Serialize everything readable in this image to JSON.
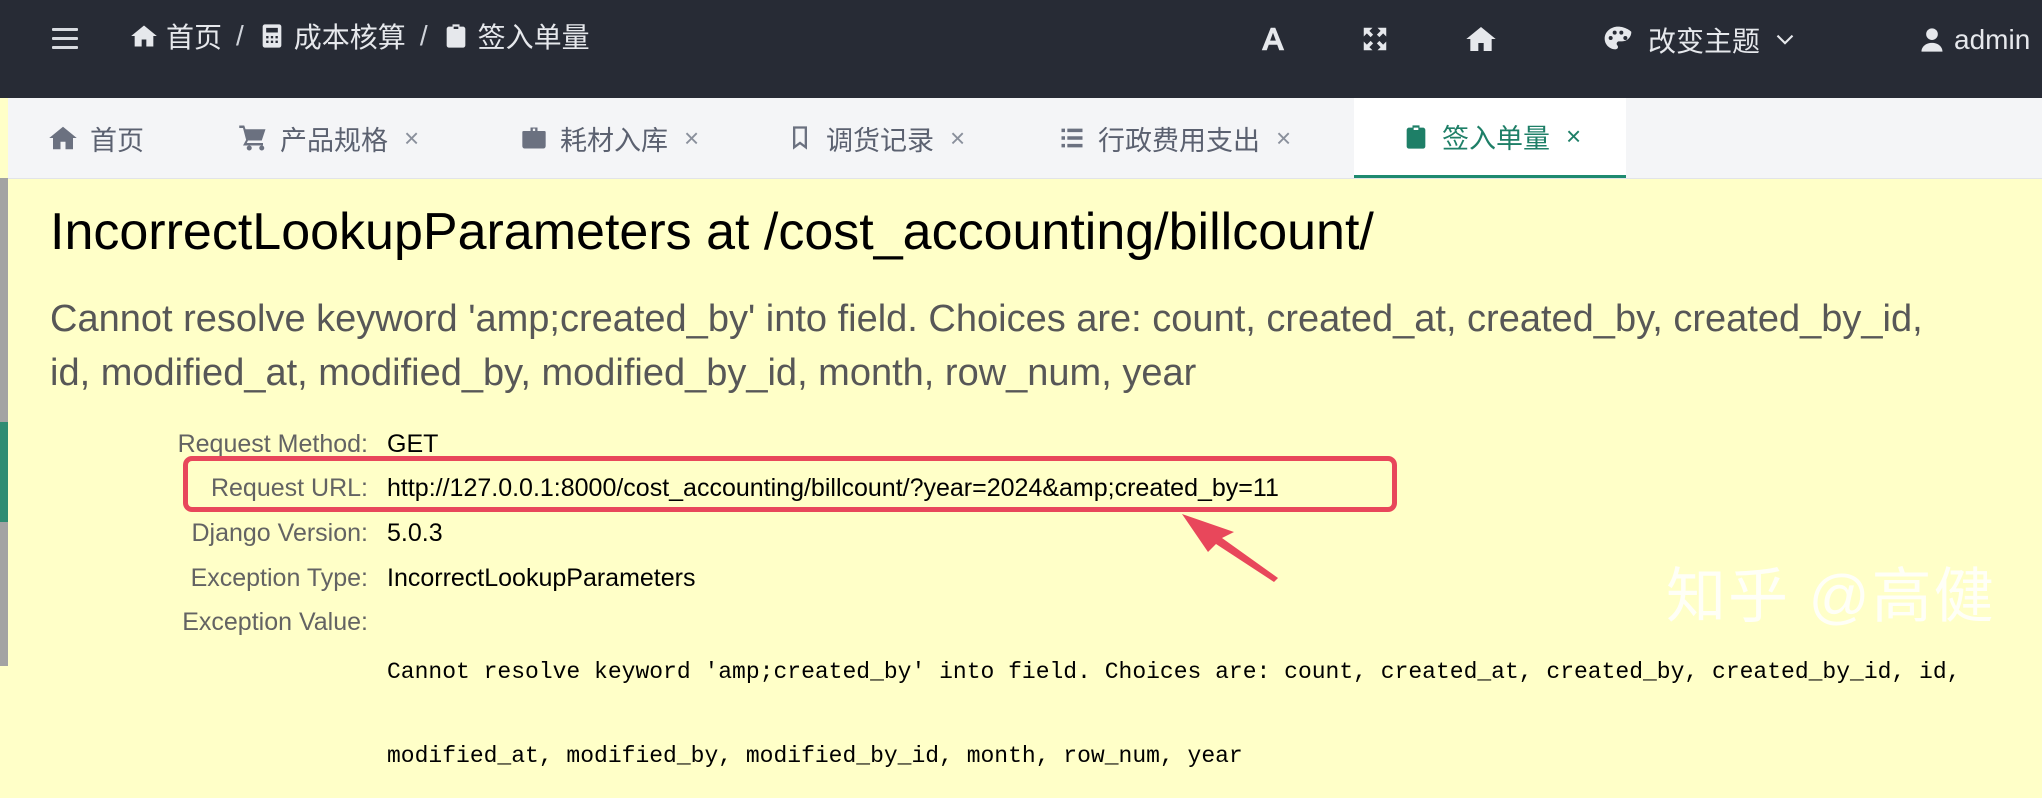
{
  "navbar": {
    "breadcrumb": [
      {
        "label": "首页",
        "icon": "home-icon"
      },
      {
        "label": "成本核算",
        "icon": "calculator-icon"
      },
      {
        "label": "签入单量",
        "icon": "clipboard-icon"
      }
    ],
    "separator": "/",
    "icons": [
      "font-size-icon",
      "fullscreen-icon",
      "home-icon"
    ],
    "theme_label": "改变主题",
    "user_label": "admin"
  },
  "tabs": [
    {
      "label": "首页",
      "icon": "home-icon",
      "closable": false,
      "active": false
    },
    {
      "label": "产品规格",
      "icon": "cart-icon",
      "closable": true,
      "active": false
    },
    {
      "label": "耗材入库",
      "icon": "briefcase-icon",
      "closable": true,
      "active": false
    },
    {
      "label": "调货记录",
      "icon": "bookmark-icon",
      "closable": true,
      "active": false
    },
    {
      "label": "行政费用支出",
      "icon": "list-icon",
      "closable": true,
      "active": false
    },
    {
      "label": "签入单量",
      "icon": "clipboard-icon",
      "closable": true,
      "active": true
    }
  ],
  "tab_close": "×",
  "error": {
    "title": "IncorrectLookupParameters at /cost_accounting/billcount/",
    "message": "Cannot resolve keyword 'amp;created_by' into field. Choices are: count, created_at, created_by, created_by_id, id, modified_at, modified_by, modified_by_id, month, row_num, year",
    "request_method_label": "Request Method:",
    "request_method": "GET",
    "request_url_label": "Request URL:",
    "request_url": "http://127.0.0.1:8000/cost_accounting/billcount/?year=2024&amp;created_by=11",
    "django_version_label": "Django Version:",
    "django_version": "5.0.3",
    "exception_type_label": "Exception Type:",
    "exception_type": "IncorrectLookupParameters",
    "exception_value_label": "Exception Value:",
    "exception_value_line1": "Cannot resolve keyword 'amp;created_by' into field. Choices are: count, created_at, created_by, created_by_id, id,",
    "exception_value_line2": "modified_at, modified_by, modified_by_id, month, row_num, year"
  },
  "watermark": "知乎 @高健",
  "colors": {
    "navbar_bg": "#272b35",
    "content_bg": "#ffffc8",
    "active_tab": "#1e7f67",
    "annotation": "#e8475b"
  }
}
